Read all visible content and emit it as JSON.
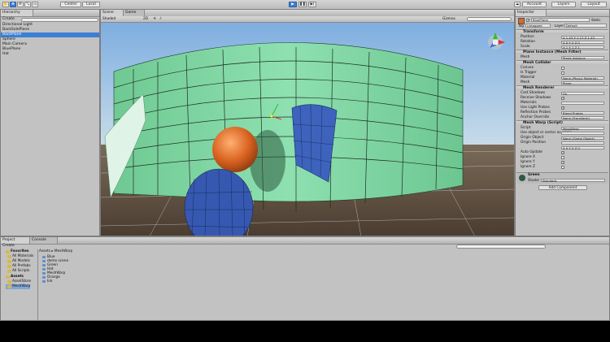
{
  "toolbar": {
    "tools": [
      "hand-icon",
      "move-icon",
      "rotate-icon",
      "scale-icon",
      "rect-icon"
    ],
    "pivot_label": "Center",
    "space_label": "Local",
    "play_icon": "play-icon",
    "pause_icon": "pause-icon",
    "step_icon": "step-icon",
    "account_label": "Account",
    "layers_label": "Layers",
    "layout_label": "Layout"
  },
  "hierarchy": {
    "tab_label": "Hierarchy",
    "create_label": "Create",
    "items": [
      {
        "label": "Directional Light",
        "selected": false
      },
      {
        "label": "BackSidePlane",
        "selected": false
      },
      {
        "label": "BackPlane",
        "selected": true
      },
      {
        "label": "Sphere",
        "selected": false
      },
      {
        "label": "Main Camera",
        "selected": false
      },
      {
        "label": "BluePlane",
        "selected": false
      },
      {
        "label": "Hat",
        "selected": false
      }
    ]
  },
  "scene": {
    "tab_scene": "Scene",
    "tab_game": "Game",
    "shading_mode": "Shaded",
    "mode_2d": "2D",
    "gizmos_label": "Gizmos",
    "sky_color": "#9fc4e8",
    "ground_color": "#5c4b3a",
    "green_surface_color": "#7fd7a4",
    "blue_surface_color": "#3b5fb8",
    "sphere_color": "#d86a26"
  },
  "inspector": {
    "tab_label": "Inspector",
    "object_name": "BluePlane",
    "static_label": "Static",
    "tag_label": "Tag",
    "tag_value": "Untagged",
    "layer_label": "Layer",
    "layer_value": "Default",
    "transform": {
      "title": "Transform",
      "rows": [
        {
          "label": "Position",
          "value": "X 1.43   Y 1.17   Z 1.43"
        },
        {
          "label": "Rotation",
          "value": "X 0   Y 0   Z 0"
        },
        {
          "label": "Scale",
          "value": "X 1   Y 1   Z 1"
        }
      ]
    },
    "mesh_filter": {
      "title": "Plane Instance (Mesh Filter)",
      "mesh_label": "Mesh",
      "mesh_value": "Plane Instance"
    },
    "mesh_collider": {
      "title": "Mesh Collider",
      "rows": [
        {
          "label": "Convex",
          "value": ""
        },
        {
          "label": "Is Trigger",
          "value": ""
        },
        {
          "label": "Material",
          "value": "None (Physic Material)"
        },
        {
          "label": "Mesh",
          "value": "Plane"
        }
      ]
    },
    "mesh_renderer": {
      "title": "Mesh Renderer",
      "rows": [
        {
          "label": "Cast Shadows",
          "value": "On"
        },
        {
          "label": "Receive Shadows",
          "value": "✓"
        },
        {
          "label": "Materials",
          "value": ""
        },
        {
          "label": "Use Light Probes",
          "value": "✓"
        },
        {
          "label": "Reflection Probes",
          "value": "Blend Probes"
        },
        {
          "label": "Anchor Override",
          "value": "None (Transform)"
        }
      ]
    },
    "mesh_warp": {
      "title": "Mesh Warp (Script)",
      "rows": [
        {
          "label": "Script",
          "value": "MeshWarp"
        },
        {
          "label": "Use object or vector as origin",
          "value": ""
        },
        {
          "label": "Origin Object",
          "value": "None (Game Object)"
        },
        {
          "label": "Origin Position",
          "value": ""
        },
        {
          "label": "",
          "value": "X 0   Y 0   Z 0"
        },
        {
          "label": "Auto Update",
          "value": "✓"
        },
        {
          "label": "Ignore X",
          "value": ""
        },
        {
          "label": "Ignore Y",
          "value": "✓"
        },
        {
          "label": "Ignore Z",
          "value": ""
        }
      ]
    },
    "material": {
      "name": "Green",
      "shader_label": "Shader",
      "shader_value": "Standard"
    },
    "add_component_label": "Add Component"
  },
  "project": {
    "tab_project": "Project",
    "tab_console": "Console",
    "create_label": "Create",
    "favorites_label": "Favorites",
    "favorites": [
      "All Materials",
      "All Models",
      "All Prefabs",
      "All Scripts"
    ],
    "assets_label": "Assets",
    "asset_folders": [
      "AssetStore",
      "MeshWarp"
    ],
    "breadcrumb": "Assets ▸ MeshWarp",
    "assets": [
      "Blue",
      "demo scene",
      "Green",
      "Hat",
      "MeshWarp",
      "Orange",
      "Ink"
    ]
  }
}
